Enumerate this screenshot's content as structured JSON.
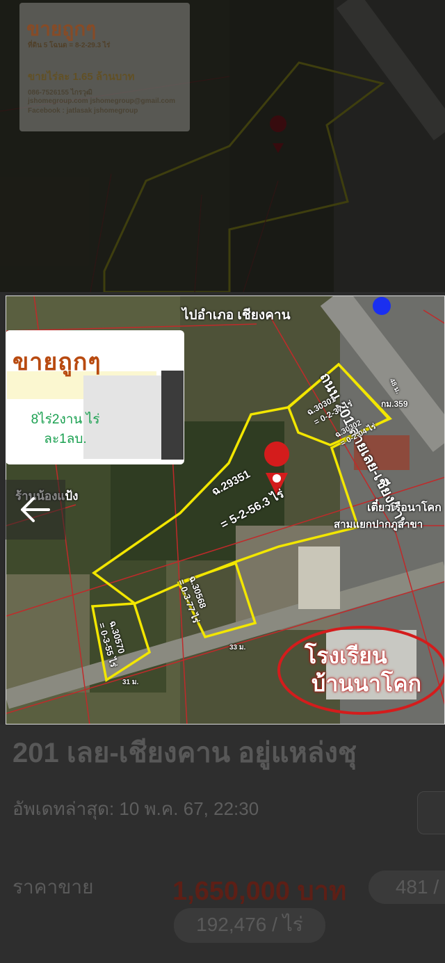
{
  "background_card": {
    "title": "ขายถูกๆ",
    "line1": "ที่ดิน 5 โฉนด = 8-2-29.3 ไร่",
    "line2": "ขายไร่ละ 1.65 ล้านบาท",
    "line3": "086-7526155 ไกรวุฒิ",
    "line4": "jshomegroup.com  jshomegroup@gmail.com",
    "line5": "Facebook : jatlasak jshomegroup"
  },
  "main_image": {
    "card_title": "ขายถูกๆ",
    "card_note": "8ไร่2งาน ไร่ละ1ลบ.",
    "labels": {
      "direction": "ไปอำเภอ เชียงคาน",
      "road": "ถนน 201 สายเลย-เชียงคาน",
      "shop": "ร้านน้องแป้ง",
      "plot_main": "ฉ.29351",
      "plot_main_area": "= 5-2-56.3 ไร่",
      "plot_30301": "ฉ.30301",
      "plot_30301_area": "= 0-2-37 ไร่",
      "plot_30302": "ฉ.30302",
      "plot_30302_area": "= 0-2-04 ไร่",
      "plot_30568": "ฉ.30568",
      "plot_30568_area": "= 0-3-77 ไร่",
      "plot_30570": "ฉ.30570",
      "plot_30570_area": "= 0-3-55 ไร่",
      "junction": "สามแยกปากภูสาขา",
      "boat_noodle": "เตี๋ยวเรือนาโคก",
      "school_line1": "โรงเรียน",
      "school_line2": "บ้านนาโคก",
      "km": "กม.359",
      "width_48": "48 ม.",
      "width_33": "33 ม.",
      "width_31": "31 ม."
    },
    "colors": {
      "boundary": "#f2e600",
      "pin": "#e3192b",
      "school_circle": "#d41c1c"
    }
  },
  "listing": {
    "title": "201 เลย-เชียงคาน อยู่แหล่งชุ",
    "updated": "อัพเดทล่าสุด: 10 พ.ค. 67, 22:30",
    "price_label": "ราคาขาย",
    "price_value": "1,650,000 บาท",
    "price_sqm": "481 /",
    "price_per_rai": "192,476 / ไร่"
  },
  "icons": {
    "back": "arrow-left-icon",
    "pin": "map-pin-icon",
    "shopping": "shopping-bag-icon"
  }
}
